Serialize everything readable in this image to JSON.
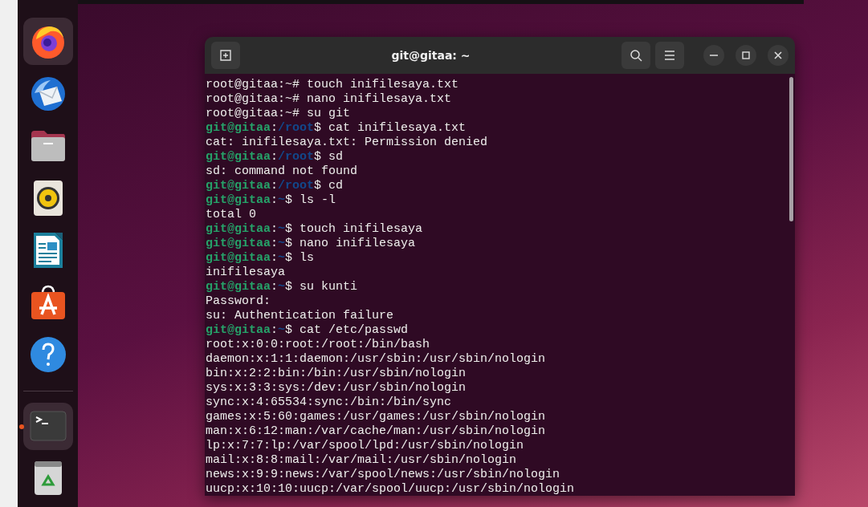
{
  "dock": {
    "items": [
      {
        "kind": "firefox",
        "highlighted": true,
        "running": false
      },
      {
        "kind": "thunderbird",
        "highlighted": false,
        "running": false
      },
      {
        "kind": "files",
        "highlighted": false,
        "running": false
      },
      {
        "kind": "rhythmbox",
        "highlighted": false,
        "running": false
      },
      {
        "kind": "writer",
        "highlighted": false,
        "running": false
      },
      {
        "kind": "appcenter",
        "highlighted": false,
        "running": false
      },
      {
        "kind": "help",
        "highlighted": false,
        "running": false
      },
      {
        "kind": "separator"
      },
      {
        "kind": "terminal",
        "highlighted": true,
        "running": true
      },
      {
        "kind": "trash",
        "highlighted": false,
        "running": false
      }
    ]
  },
  "window": {
    "title": "git@gitaa: ~"
  },
  "terminal": {
    "lines": [
      {
        "kind": "plain",
        "text": "root@gitaa:~# touch inifilesaya.txt"
      },
      {
        "kind": "plain",
        "text": "root@gitaa:~# nano inifilesaya.txt"
      },
      {
        "kind": "plain",
        "text": "root@gitaa:~# su git"
      },
      {
        "kind": "prompt",
        "user": "git@gitaa",
        "sep": ":",
        "path": "/root",
        "rest": "$ cat inifilesaya.txt"
      },
      {
        "kind": "plain",
        "text": "cat: inifilesaya.txt: Permission denied"
      },
      {
        "kind": "prompt",
        "user": "git@gitaa",
        "sep": ":",
        "path": "/root",
        "rest": "$ sd"
      },
      {
        "kind": "plain",
        "text": "sd: command not found"
      },
      {
        "kind": "prompt",
        "user": "git@gitaa",
        "sep": ":",
        "path": "/root",
        "rest": "$ cd"
      },
      {
        "kind": "prompt",
        "user": "git@gitaa",
        "sep": ":",
        "path": "~",
        "rest": "$ ls -l"
      },
      {
        "kind": "plain",
        "text": "total 0"
      },
      {
        "kind": "prompt",
        "user": "git@gitaa",
        "sep": ":",
        "path": "~",
        "rest": "$ touch inifilesaya"
      },
      {
        "kind": "prompt",
        "user": "git@gitaa",
        "sep": ":",
        "path": "~",
        "rest": "$ nano inifilesaya"
      },
      {
        "kind": "prompt",
        "user": "git@gitaa",
        "sep": ":",
        "path": "~",
        "rest": "$ ls"
      },
      {
        "kind": "plain",
        "text": "inifilesaya"
      },
      {
        "kind": "prompt",
        "user": "git@gitaa",
        "sep": ":",
        "path": "~",
        "rest": "$ su kunti"
      },
      {
        "kind": "plain",
        "text": "Password:"
      },
      {
        "kind": "plain",
        "text": "su: Authentication failure"
      },
      {
        "kind": "prompt",
        "user": "git@gitaa",
        "sep": ":",
        "path": "~",
        "rest": "$ cat /etc/passwd"
      },
      {
        "kind": "plain",
        "text": "root:x:0:0:root:/root:/bin/bash"
      },
      {
        "kind": "plain",
        "text": "daemon:x:1:1:daemon:/usr/sbin:/usr/sbin/nologin"
      },
      {
        "kind": "plain",
        "text": "bin:x:2:2:bin:/bin:/usr/sbin/nologin"
      },
      {
        "kind": "plain",
        "text": "sys:x:3:3:sys:/dev:/usr/sbin/nologin"
      },
      {
        "kind": "plain",
        "text": "sync:x:4:65534:sync:/bin:/bin/sync"
      },
      {
        "kind": "plain",
        "text": "games:x:5:60:games:/usr/games:/usr/sbin/nologin"
      },
      {
        "kind": "plain",
        "text": "man:x:6:12:man:/var/cache/man:/usr/sbin/nologin"
      },
      {
        "kind": "plain",
        "text": "lp:x:7:7:lp:/var/spool/lpd:/usr/sbin/nologin"
      },
      {
        "kind": "plain",
        "text": "mail:x:8:8:mail:/var/mail:/usr/sbin/nologin"
      },
      {
        "kind": "plain",
        "text": "news:x:9:9:news:/var/spool/news:/usr/sbin/nologin"
      },
      {
        "kind": "plain",
        "text": "uucp:x:10:10:uucp:/var/spool/uucp:/usr/sbin/nologin"
      }
    ]
  }
}
